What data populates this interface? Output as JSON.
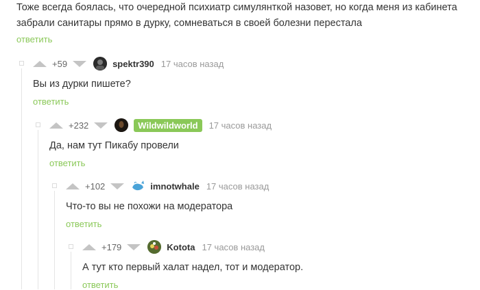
{
  "root": {
    "text_line1": "Тоже всегда боялась, что очередной психиатр симулянткой назовет, но когда меня из кабинета",
    "text_line2": "забрали санитары прямо в дурку, сомневаться в своей болезни перестала",
    "reply": "ответить"
  },
  "comments": [
    {
      "rating": "+59",
      "user": "spektr390",
      "time": "17 часов назад",
      "text": "Вы из дурки пишете?",
      "reply": "ответить",
      "avatar_icon": "dark-avatar"
    },
    {
      "rating": "+232",
      "user": "Wildwildworld",
      "time": "17 часов назад",
      "text": "Да, нам тут Пикабу провели",
      "reply": "ответить",
      "avatar_icon": "dark-avatar"
    },
    {
      "rating": "+102",
      "user": "imnotwhale",
      "time": "17 часов назад",
      "text": "Что-то вы не похожи на модератора",
      "reply": "ответить",
      "avatar_icon": "whale-avatar"
    },
    {
      "rating": "+179",
      "user": "Kotota",
      "time": "17 часов назад",
      "text": "А тут кто первый халат надел, тот и модератор.",
      "reply": "ответить",
      "avatar_icon": "colorful-avatar"
    }
  ],
  "colors": {
    "accent": "#8ac858",
    "arrow": "#c4c4c4",
    "muted": "#999999"
  }
}
